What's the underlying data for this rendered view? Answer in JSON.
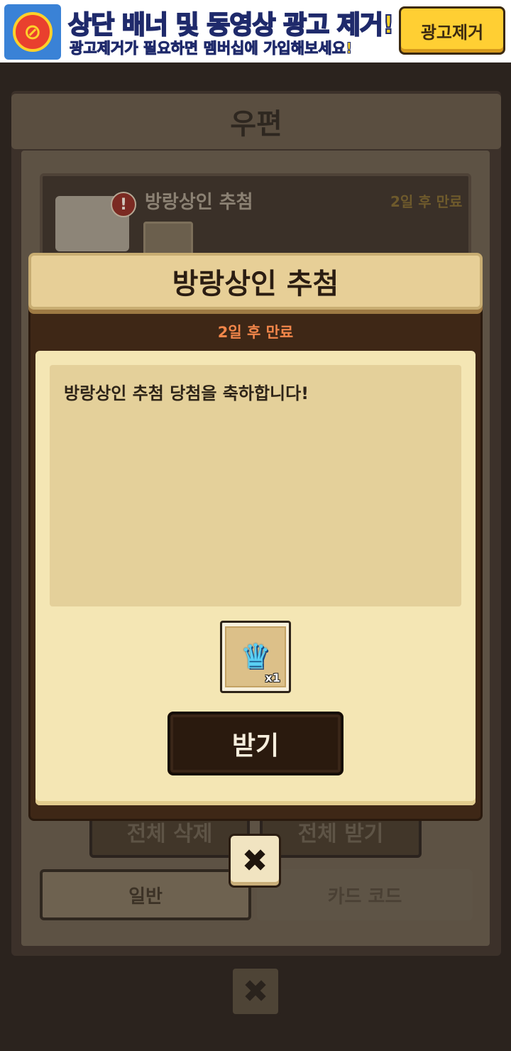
{
  "ad_banner": {
    "title": "상단 배너 및 동영상 광고 제거!",
    "subtitle": "광고제거가 필요하면 멤버십에 가입해보세요!",
    "button_label": "광고제거",
    "icon_glyph": "⊘"
  },
  "mailbox": {
    "title": "우편",
    "mail_item": {
      "title": "방랑상인 추첨",
      "expiry": "2일 후 만료",
      "alert_glyph": "!"
    },
    "delete_all_label": "전체 삭제",
    "receive_all_label": "전체 받기",
    "tabs": [
      {
        "label": "일반",
        "active": true
      },
      {
        "label": "카드 코드",
        "active": false
      }
    ],
    "close_glyph": "✖"
  },
  "dialog": {
    "title": "방랑상인 추첨",
    "expiry": "2일 후 만료",
    "message": "방랑상인 추첨 당첨을 축하합니다!",
    "reward": {
      "icon": "armor-icon",
      "glyph": "♛",
      "quantity": "x1"
    },
    "receive_label": "받기",
    "close_glyph": "✖"
  },
  "colors": {
    "accent_orange": "#f2864a",
    "banner_yellow": "#ffd326",
    "dialog_paper": "#f4e6b4"
  }
}
